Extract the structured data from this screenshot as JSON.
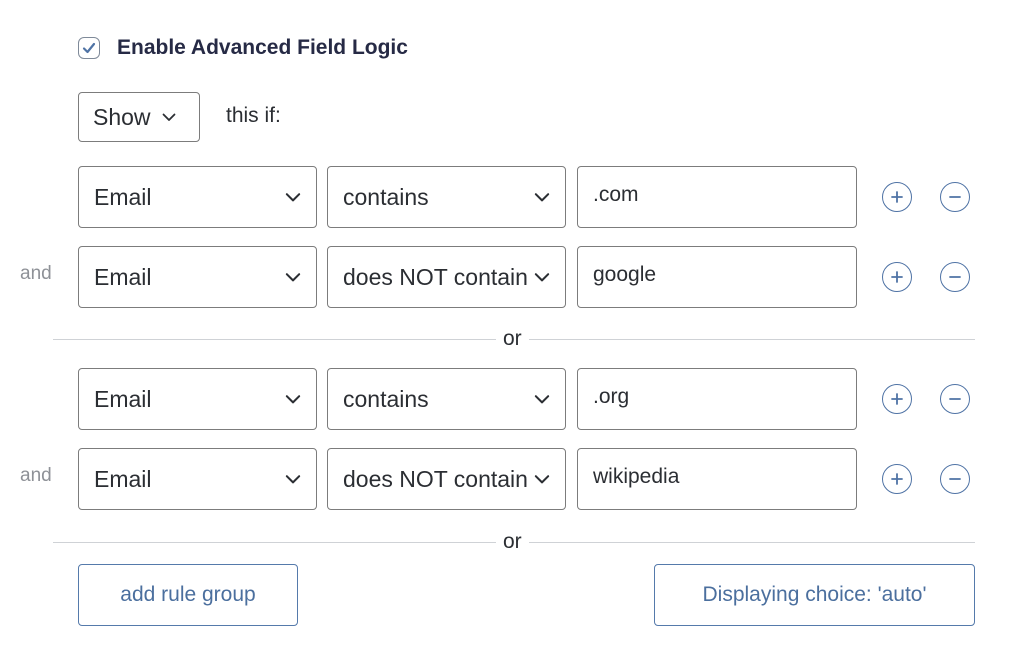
{
  "enable": {
    "label": "Enable Advanced Field Logic",
    "checked": true
  },
  "action": {
    "selected": "Show",
    "suffix": "this if:"
  },
  "groups": [
    {
      "rules": [
        {
          "field": "Email",
          "operator": "contains",
          "value": ".com"
        },
        {
          "conjunction": "and",
          "field": "Email",
          "operator": "does NOT contain",
          "value": "google"
        }
      ],
      "separator": "or"
    },
    {
      "rules": [
        {
          "field": "Email",
          "operator": "contains",
          "value": ".org"
        },
        {
          "conjunction": "and",
          "field": "Email",
          "operator": "does NOT contain",
          "value": "wikipedia"
        }
      ],
      "separator": "or"
    }
  ],
  "buttons": {
    "add_rule_group": "add rule group",
    "displaying_choice": "Displaying choice: 'auto'"
  },
  "colors": {
    "accent": "#4f73a5",
    "text": "#2b2e33",
    "muted": "#8e9197",
    "border": "#7c7c7c"
  }
}
